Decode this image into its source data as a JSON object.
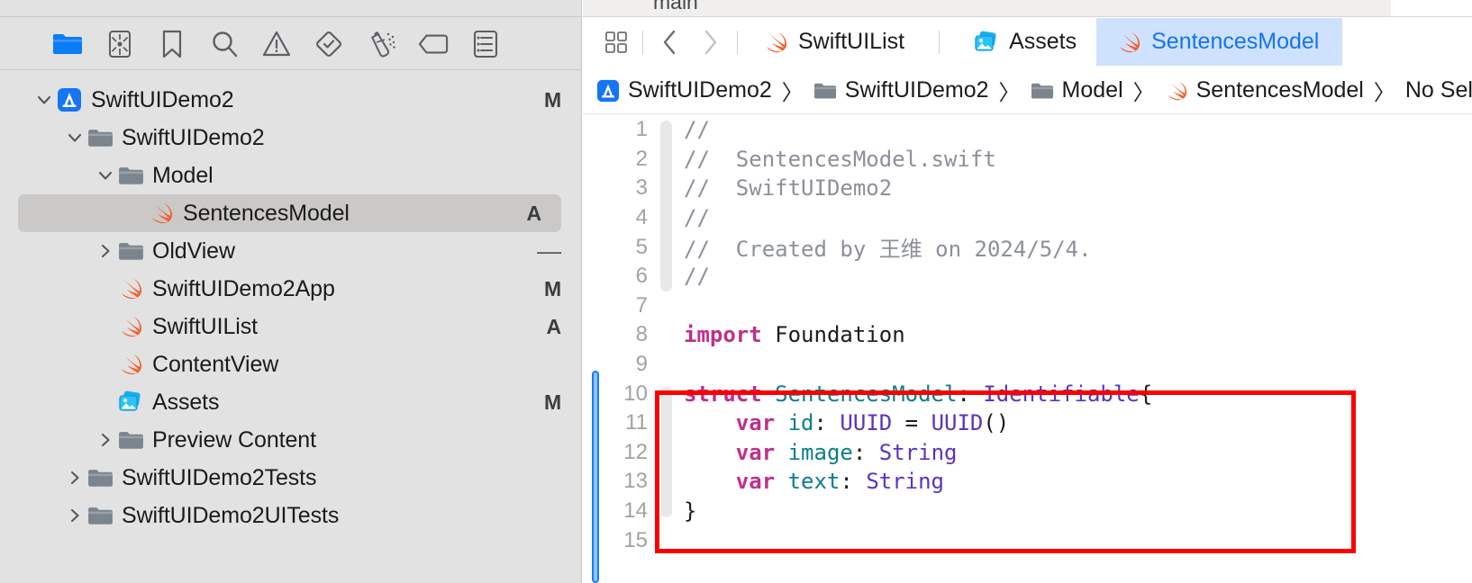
{
  "navigator": {
    "toolbar_icons": [
      {
        "name": "project-navigator-icon",
        "glyph": "folder",
        "active": true
      },
      {
        "name": "source-control-navigator-icon",
        "glyph": "source-control",
        "active": false
      },
      {
        "name": "bookmark-navigator-icon",
        "glyph": "bookmark",
        "active": false
      },
      {
        "name": "find-navigator-icon",
        "glyph": "search",
        "active": false
      },
      {
        "name": "issue-navigator-icon",
        "glyph": "warning",
        "active": false
      },
      {
        "name": "test-navigator-icon",
        "glyph": "diamond-check",
        "active": false
      },
      {
        "name": "debug-navigator-icon",
        "glyph": "spray",
        "active": false
      },
      {
        "name": "breakpoint-navigator-icon",
        "glyph": "tag",
        "active": false
      },
      {
        "name": "report-navigator-icon",
        "glyph": "report",
        "active": false
      }
    ],
    "tree": [
      {
        "label": "SwiftUIDemo2",
        "icon": "xcode-project-icon",
        "twisty": "down",
        "depth": 0,
        "status": "M",
        "selected": false
      },
      {
        "label": "SwiftUIDemo2",
        "icon": "folder-icon",
        "twisty": "down",
        "depth": 1,
        "status": "",
        "selected": false
      },
      {
        "label": "Model",
        "icon": "folder-icon",
        "twisty": "down",
        "depth": 2,
        "status": "",
        "selected": false
      },
      {
        "label": "SentencesModel",
        "icon": "swift-icon",
        "twisty": "none",
        "depth": 3,
        "status": "A",
        "selected": true
      },
      {
        "label": "OldView",
        "icon": "folder-icon",
        "twisty": "right",
        "depth": 2,
        "status": "-",
        "selected": false
      },
      {
        "label": "SwiftUIDemo2App",
        "icon": "swift-icon",
        "twisty": "none",
        "depth": 2,
        "status": "M",
        "selected": false
      },
      {
        "label": "SwiftUIList",
        "icon": "swift-icon",
        "twisty": "none",
        "depth": 2,
        "status": "A",
        "selected": false
      },
      {
        "label": "ContentView",
        "icon": "swift-icon",
        "twisty": "none",
        "depth": 2,
        "status": "",
        "selected": false
      },
      {
        "label": "Assets",
        "icon": "assets-icon",
        "twisty": "none",
        "depth": 2,
        "status": "M",
        "selected": false
      },
      {
        "label": "Preview Content",
        "icon": "folder-icon",
        "twisty": "right",
        "depth": 2,
        "status": "",
        "selected": false
      },
      {
        "label": "SwiftUIDemo2Tests",
        "icon": "folder-icon",
        "twisty": "right",
        "depth": 1,
        "status": "",
        "selected": false
      },
      {
        "label": "SwiftUIDemo2UITests",
        "icon": "folder-icon",
        "twisty": "right",
        "depth": 1,
        "status": "",
        "selected": false
      }
    ]
  },
  "editor": {
    "top_strip_label": "main",
    "tabs": [
      {
        "label": "SwiftUIList",
        "icon": "swift-icon",
        "active": false
      },
      {
        "label": "Assets",
        "icon": "assets-icon",
        "active": false
      },
      {
        "label": "SentencesModel",
        "icon": "swift-icon",
        "active": true
      }
    ],
    "breadcrumb": [
      {
        "label": "SwiftUIDemo2",
        "icon": "xcode-project-icon"
      },
      {
        "label": "SwiftUIDemo2",
        "icon": "folder-icon"
      },
      {
        "label": "Model",
        "icon": "folder-icon"
      },
      {
        "label": "SentencesModel",
        "icon": "swift-icon"
      },
      {
        "label": "No Selection",
        "icon": "none"
      }
    ],
    "breadcrumb_separator": "〉"
  },
  "code": {
    "lines": [
      {
        "n": "1",
        "tokens": [
          {
            "t": "//",
            "c": "cm"
          }
        ]
      },
      {
        "n": "2",
        "tokens": [
          {
            "t": "//  SentencesModel.swift",
            "c": "cm"
          }
        ]
      },
      {
        "n": "3",
        "tokens": [
          {
            "t": "//  SwiftUIDemo2",
            "c": "cm"
          }
        ]
      },
      {
        "n": "4",
        "tokens": [
          {
            "t": "//",
            "c": "cm"
          }
        ]
      },
      {
        "n": "5",
        "tokens": [
          {
            "t": "//  Created by 王维 on 2024/5/4.",
            "c": "cm"
          }
        ]
      },
      {
        "n": "6",
        "tokens": [
          {
            "t": "//",
            "c": "cm"
          }
        ]
      },
      {
        "n": "7",
        "tokens": []
      },
      {
        "n": "8",
        "tokens": [
          {
            "t": "import",
            "c": "kw"
          },
          {
            "t": " Foundation",
            "c": "pl"
          }
        ]
      },
      {
        "n": "9",
        "tokens": []
      },
      {
        "n": "10",
        "tokens": [
          {
            "t": "struct",
            "c": "kw"
          },
          {
            "t": " ",
            "c": "pl"
          },
          {
            "t": "SentencesModel",
            "c": "id"
          },
          {
            "t": ": ",
            "c": "pl"
          },
          {
            "t": "Identifiable",
            "c": "tp"
          },
          {
            "t": "{",
            "c": "pl"
          }
        ]
      },
      {
        "n": "11",
        "tokens": [
          {
            "t": "    ",
            "c": "pl"
          },
          {
            "t": "var",
            "c": "kw"
          },
          {
            "t": " ",
            "c": "pl"
          },
          {
            "t": "id",
            "c": "id"
          },
          {
            "t": ": ",
            "c": "pl"
          },
          {
            "t": "UUID",
            "c": "tp"
          },
          {
            "t": " = ",
            "c": "pl"
          },
          {
            "t": "UUID",
            "c": "tp"
          },
          {
            "t": "()",
            "c": "pl"
          }
        ]
      },
      {
        "n": "12",
        "tokens": [
          {
            "t": "    ",
            "c": "pl"
          },
          {
            "t": "var",
            "c": "kw"
          },
          {
            "t": " ",
            "c": "pl"
          },
          {
            "t": "image",
            "c": "id"
          },
          {
            "t": ": ",
            "c": "pl"
          },
          {
            "t": "String",
            "c": "tp"
          }
        ]
      },
      {
        "n": "13",
        "tokens": [
          {
            "t": "    ",
            "c": "pl"
          },
          {
            "t": "var",
            "c": "kw"
          },
          {
            "t": " ",
            "c": "pl"
          },
          {
            "t": "text",
            "c": "id"
          },
          {
            "t": ": ",
            "c": "pl"
          },
          {
            "t": "String",
            "c": "tp"
          }
        ]
      },
      {
        "n": "14",
        "tokens": [
          {
            "t": "}",
            "c": "pl"
          }
        ]
      },
      {
        "n": "15",
        "tokens": []
      }
    ]
  },
  "annotation": {
    "highlight_color": "#fb0000",
    "highlight_shape": "rectangle",
    "highlight_target": "struct SentencesModel declaration"
  },
  "colors": {
    "accent": "#1273f5",
    "active_tab_bg": "#cfe2fd",
    "sidebar_bg": "#e2e2e2",
    "selected_row_bg": "#cbc9c7",
    "keyword": "#bf2f8d",
    "type": "#5a33c4",
    "identifier": "#0c7d8c",
    "comment": "#8c9099",
    "changebar": "#8ec2fd"
  }
}
